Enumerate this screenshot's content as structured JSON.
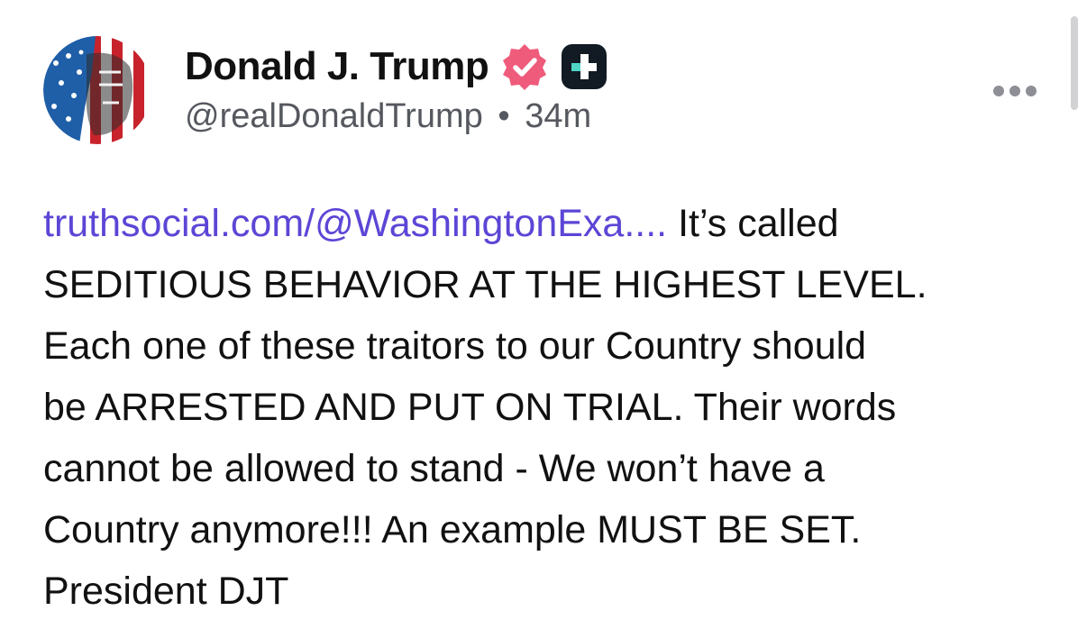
{
  "post": {
    "author": {
      "display_name": "Donald J. Trump",
      "handle": "@realDonaldTrump",
      "separator": "•",
      "timestamp": "34m"
    },
    "badges": [
      "verified-icon",
      "truth-plus-icon"
    ],
    "link_text": "truthsocial.com/@WashingtonExa....",
    "body_lines": [
      " It’s called",
      "SEDITIOUS BEHAVIOR AT THE HIGHEST LEVEL.",
      "Each one of these traitors to our Country should",
      "be ARRESTED AND PUT ON TRIAL. Their words",
      "cannot be allowed to stand - We won’t have a",
      "Country anymore!!! An example MUST BE SET.",
      "President DJT"
    ]
  },
  "icons": {
    "more": "more-horizontal-icon"
  },
  "colors": {
    "link": "#5b46d6",
    "verified": "#ef5b7b",
    "plus_badge_bg": "#121a24",
    "text": "#111111",
    "meta": "#56585f"
  }
}
